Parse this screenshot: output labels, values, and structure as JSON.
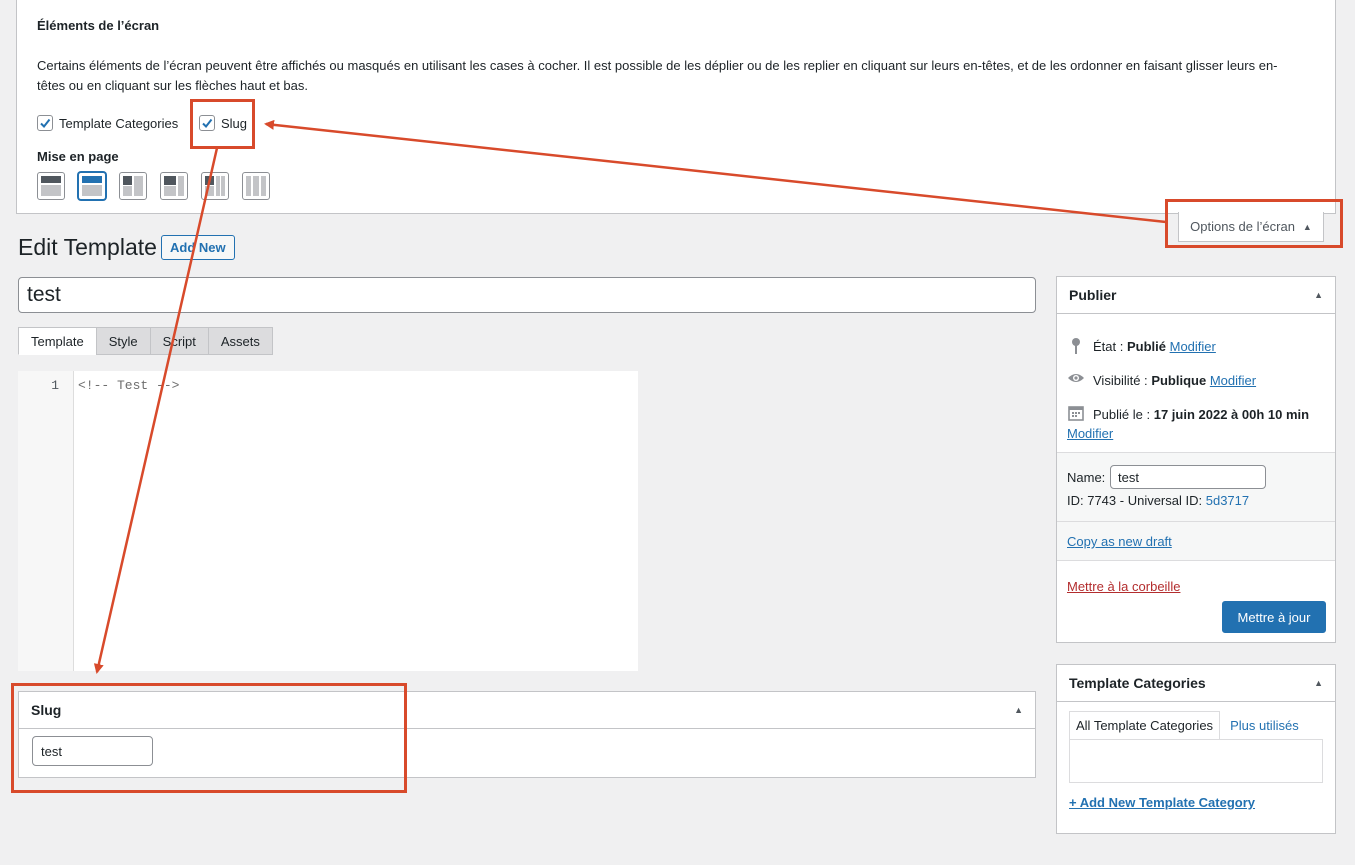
{
  "screen_options": {
    "title": "Éléments de l’écran",
    "description": "Certains éléments de l’écran peuvent être affichés ou masqués en utilisant les cases à cocher. Il est possible de les déplier ou de les replier en cliquant sur leurs en-têtes, et de les ordonner en faisant glisser leurs en-têtes ou en cliquant sur les flèches haut et bas.",
    "checkboxes": [
      {
        "label": "Template Categories",
        "checked": true
      },
      {
        "label": "Slug",
        "checked": true
      }
    ],
    "layout_title": "Mise en page",
    "layout_options": [
      "1-column",
      "2-columns",
      "3-columns",
      "4-columns",
      "5-columns",
      "6-columns"
    ],
    "layout_selected": "2-columns",
    "tab_label": "Options de l’écran"
  },
  "header": {
    "title": "Edit Template",
    "add_new_label": "Add New"
  },
  "post_title": "test",
  "editor": {
    "tabs": [
      "Template",
      "Style",
      "Script",
      "Assets"
    ],
    "active_tab": "Template",
    "line_number": "1",
    "code": "<!-- Test -->"
  },
  "slug_box": {
    "title": "Slug",
    "value": "test"
  },
  "publish_box": {
    "title": "Publier",
    "status_label": "État :",
    "status_value": "Publié",
    "visibility_label": "Visibilité :",
    "visibility_value": "Publique",
    "published_label": "Publié le :",
    "published_value": "17 juin 2022 à 00h 10 min",
    "edit_link": "Modifier",
    "name_label": "Name:",
    "name_value": "test",
    "id_text": "ID: 7743 - Universal ID:",
    "universal_id": "5d3717",
    "copy_draft": "Copy as new draft",
    "trash": "Mettre à la corbeille",
    "update": "Mettre à jour"
  },
  "categories_box": {
    "title": "Template Categories",
    "tab_all": "All Template Categories",
    "tab_popular": "Plus utilisés",
    "add_new": "+ Add New Template Category"
  },
  "colors": {
    "accent": "#2271b1",
    "annotation": "#d84a2b",
    "danger": "#b32d2e"
  }
}
